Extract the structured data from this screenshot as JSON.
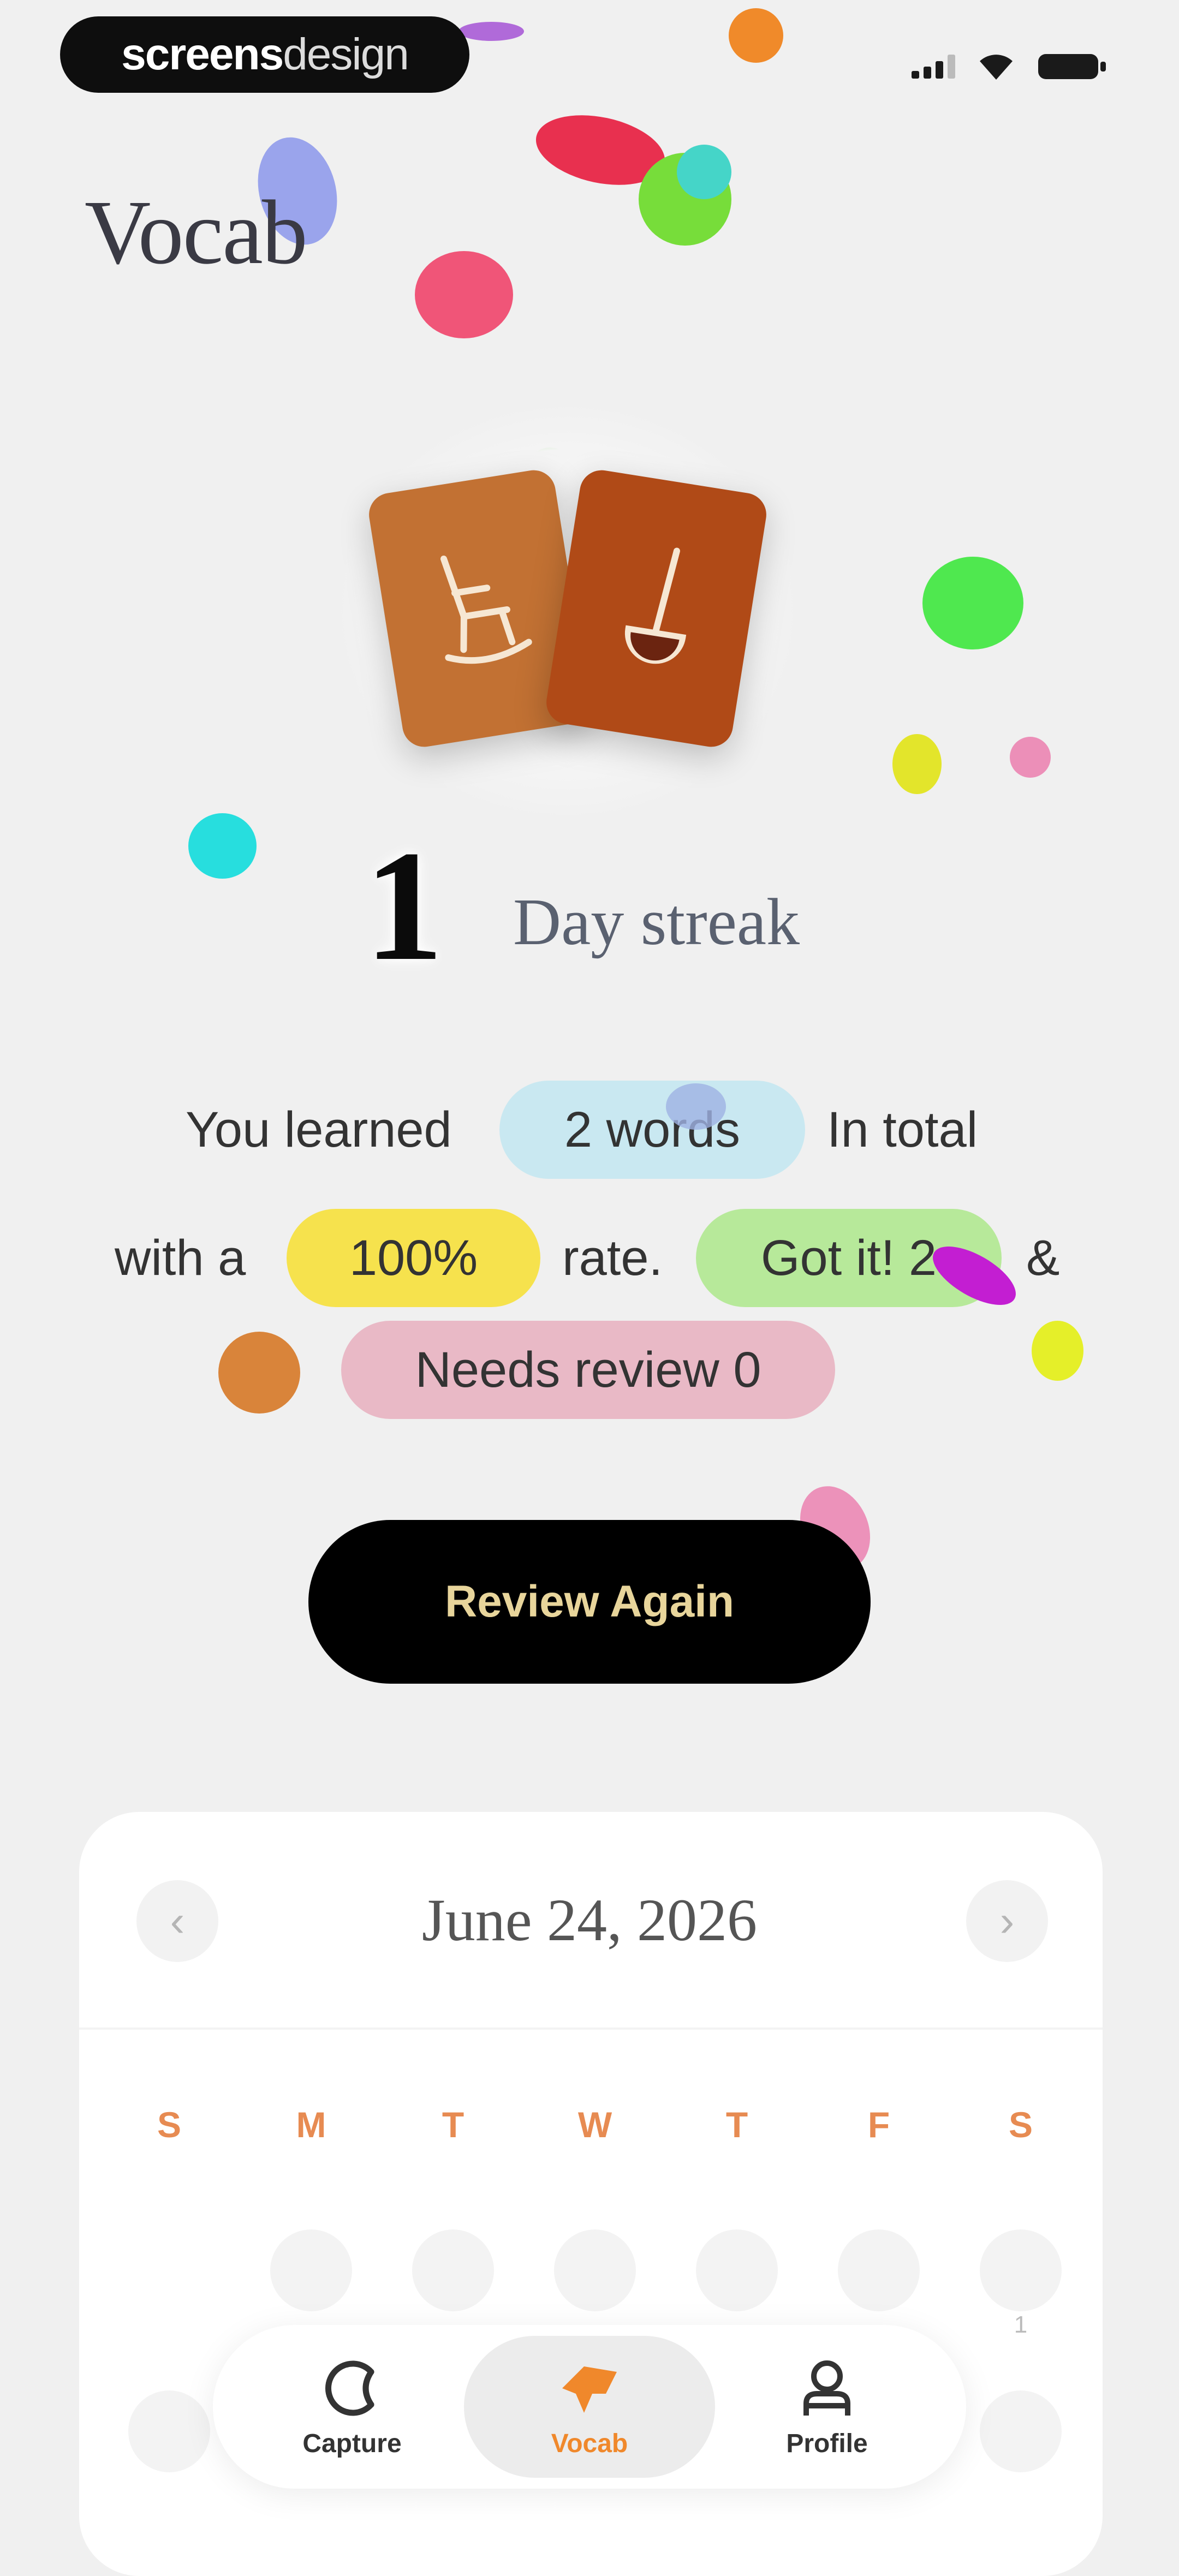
{
  "watermark": {
    "bold": "screens",
    "light": "design"
  },
  "page": {
    "title": "Vocab"
  },
  "streak": {
    "count": "1",
    "label": "Day streak"
  },
  "summary": {
    "part1": "You learned",
    "words_pill": "2 words",
    "part2": "In total",
    "part3": "with a",
    "rate_pill": "100%",
    "part4": "rate.",
    "gotit_pill": "Got it! 2",
    "part5": "&",
    "review_pill": "Needs review 0"
  },
  "actions": {
    "review_again": "Review Again"
  },
  "calendar": {
    "title": "June 24, 2026",
    "prev": "‹",
    "next": "›",
    "weekdays": [
      "S",
      "M",
      "T",
      "W",
      "T",
      "F",
      "S"
    ],
    "visible_day": "1"
  },
  "nav": {
    "items": [
      {
        "label": "Capture",
        "icon": "capture-icon"
      },
      {
        "label": "Vocab",
        "icon": "vocab-icon",
        "active": true
      },
      {
        "label": "Profile",
        "icon": "profile-icon"
      }
    ]
  },
  "colors": {
    "accent": "#f0882b",
    "words_pill": "#c9e8f1",
    "rate_pill": "#f6e24d",
    "gotit_pill": "#b7e99a",
    "review_pill": "#e9b9c6",
    "card_left": "#c27133",
    "card_right": "#b04a17"
  }
}
